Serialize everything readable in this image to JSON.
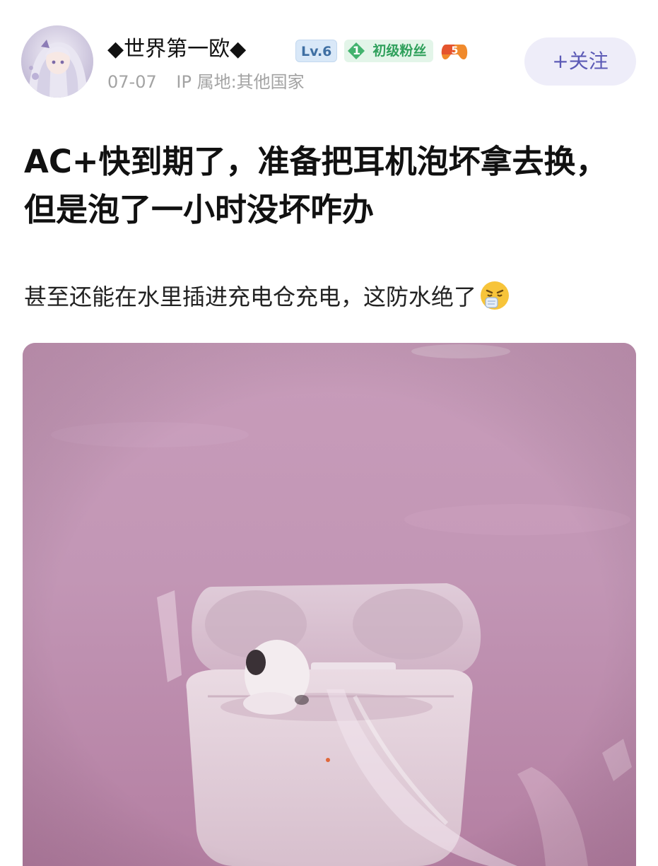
{
  "author": {
    "name": "◆世界第一欧◆",
    "level": "Lv.6",
    "fan_badge_level": "1",
    "fan_badge_label": "初级粉丝",
    "game_badge_level": "5",
    "date": "07-07",
    "ip_location": "IP 属地:其他国家",
    "avatar_icon": "anime-girl-avatar"
  },
  "actions": {
    "follow_label": "+关注"
  },
  "post": {
    "title": "AC+快到期了，准备把耳机泡坏拿去换，但是泡了一小时没坏咋办",
    "body": "甚至还能在水里插进充电仓充电，这防水绝了",
    "emoji": "sneezing-face-emoji"
  },
  "colors": {
    "accent": "#5c5ab6",
    "follow_bg": "#eeedf9",
    "level_badge": "#3f6fa3",
    "fan_badge": "#2fa05b",
    "meta_text": "#a3a3a3",
    "photo_water": "#c495b4"
  }
}
